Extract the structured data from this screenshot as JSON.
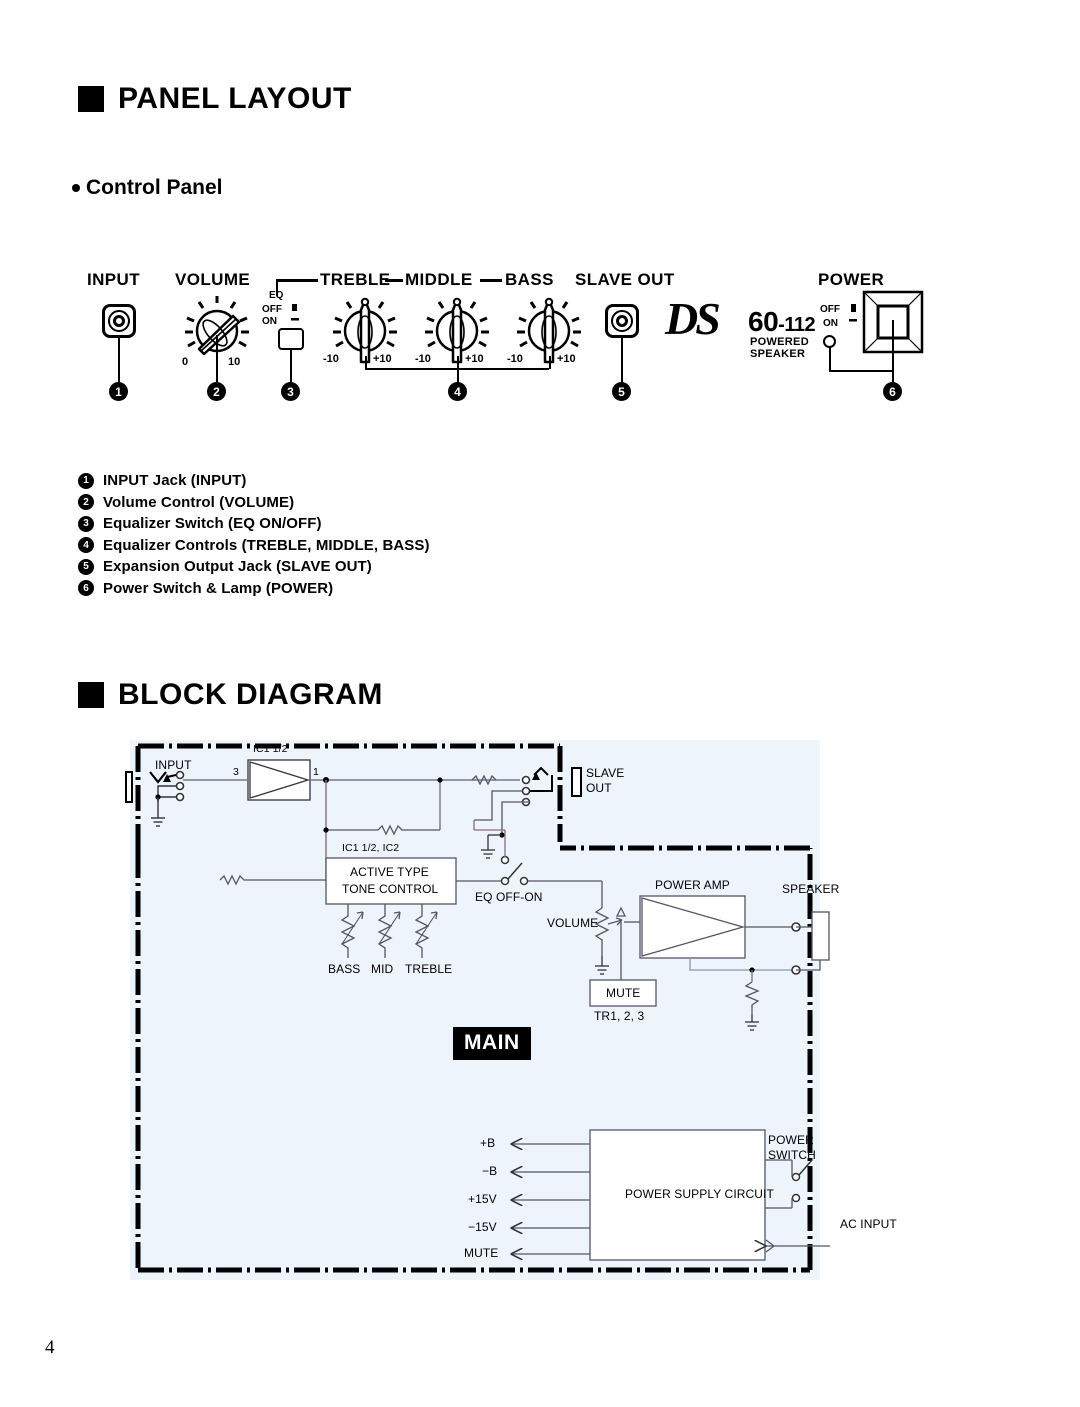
{
  "page": {
    "number": "4"
  },
  "sections": {
    "panel_layout": {
      "title": "PANEL LAYOUT"
    },
    "control_panel": {
      "title": "Control Panel"
    },
    "block_diagram": {
      "title": "BLOCK DIAGRAM"
    }
  },
  "control_panel": {
    "labels": {
      "input": "INPUT",
      "volume": "VOLUME",
      "treble": "TREBLE",
      "middle": "MIDDLE",
      "bass": "BASS",
      "slave_out": "SLAVE OUT",
      "power": "POWER"
    },
    "eq_switch": {
      "title": "EQ",
      "off": "OFF",
      "on": "ON"
    },
    "power_switch": {
      "off": "OFF",
      "on": "ON"
    },
    "volume_scale": {
      "min": "0",
      "max": "10"
    },
    "eq_scale": {
      "min": "-10",
      "max": "+10"
    },
    "logo": {
      "brand": "DS",
      "model": "60",
      "model_suffix": "-112",
      "tagline": "POWERED SPEAKER"
    },
    "callouts": [
      "1",
      "2",
      "3",
      "4",
      "5",
      "6"
    ]
  },
  "legend": {
    "items": [
      {
        "num": "1",
        "text": "INPUT Jack (INPUT)"
      },
      {
        "num": "2",
        "text": "Volume Control (VOLUME)"
      },
      {
        "num": "3",
        "text": "Equalizer Switch (EQ ON/OFF)"
      },
      {
        "num": "4",
        "text": "Equalizer Controls (TREBLE, MIDDLE, BASS)"
      },
      {
        "num": "5",
        "text": "Expansion Output Jack (SLAVE OUT)"
      },
      {
        "num": "6",
        "text": "Power Switch & Lamp (POWER)"
      }
    ]
  },
  "block_diagram": {
    "input_label": "INPUT",
    "preamp_ic": "IC1 1/2",
    "preamp_pin_in": "3",
    "preamp_pin_out": "1",
    "slave_out": "SLAVE\nOUT",
    "slave_out_line1": "SLAVE",
    "slave_out_line2": "OUT",
    "tone_ic": "IC1 1/2, IC2",
    "tone_block_line1": "ACTIVE TYPE",
    "tone_block_line2": "TONE CONTROL",
    "tone_controls": [
      "BASS",
      "MID",
      "TREBLE"
    ],
    "eq_switch_label": "EQ OFF-ON",
    "volume_label": "VOLUME",
    "power_amp": "POWER AMP",
    "speaker": "SPEAKER",
    "mute_block": "MUTE",
    "mute_parts": "TR1, 2, 3",
    "main_tag": "MAIN",
    "psu_block": "POWER SUPPLY CIRCUIT",
    "psu_rails": [
      "+B",
      "−B",
      "+15V",
      "−15V",
      "MUTE"
    ],
    "power_switch_line1": "POWER",
    "power_switch_line2": "SWITCH",
    "ac_input": "AC INPUT"
  },
  "colors": {
    "diagram_background": "#edf4fb",
    "ink": "#000000",
    "wire": "#555566"
  }
}
